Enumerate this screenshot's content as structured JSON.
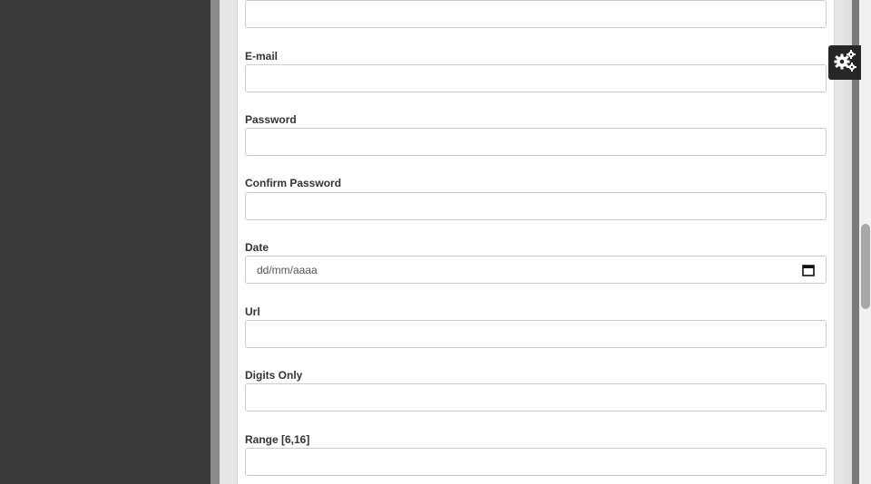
{
  "form": {
    "fields": [
      {
        "label": "",
        "value": "",
        "type": "text"
      },
      {
        "label": "E-mail",
        "value": "",
        "type": "email"
      },
      {
        "label": "Password",
        "value": "",
        "type": "password"
      },
      {
        "label": "Confirm Password",
        "value": "",
        "type": "password"
      },
      {
        "label": "Date",
        "value": "",
        "placeholder": "dd/mm/aaaa",
        "type": "date"
      },
      {
        "label": "Url",
        "value": "",
        "type": "url"
      },
      {
        "label": "Digits Only",
        "value": "",
        "type": "text"
      },
      {
        "label": "Range [6,16]",
        "value": "",
        "type": "text"
      }
    ]
  },
  "settings_panel": {
    "icon": "gears-icon"
  },
  "colors": {
    "sidebar": "#393939",
    "settings_button": "#262626",
    "label": "#333333",
    "input_border": "#cccccc"
  }
}
